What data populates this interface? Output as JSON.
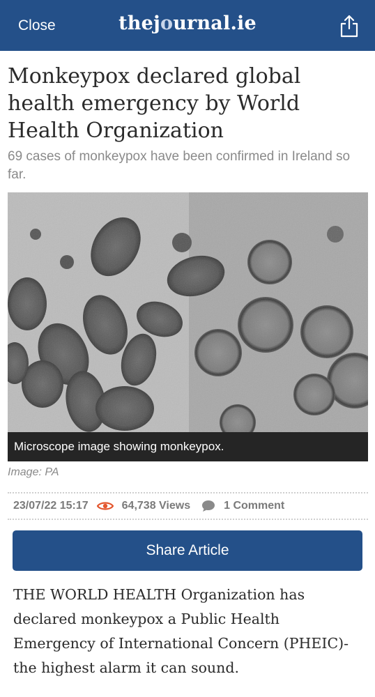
{
  "topbar": {
    "close_label": "Close",
    "brand_prefix": "the",
    "brand_mid": "j",
    "brand_o": "o",
    "brand_rest": "urnal",
    "brand_suffix": ".ie",
    "share_icon": "share-icon",
    "bg_color": "#245089"
  },
  "article": {
    "headline": "Monkeypox declared global health emergency by World Health Organization",
    "subtitle": "69 cases of monkeypox have been confirmed in Ireland so far.",
    "image_caption": "Microscope image showing monkeypox.",
    "image_credit": "Image: PA",
    "date": "23/07/22 15:17",
    "views_icon": "eye-icon",
    "views": "64,738 Views",
    "comments_icon": "comment-icon",
    "comments": "1 Comment",
    "share_button": "Share Article",
    "body": "THE WORLD HEALTH Organization has declared monkeypox a Public Health Emergency of International Concern (PHEIC)- the highest alarm it can sound."
  },
  "colors": {
    "accent": "#245089",
    "eye_icon": "#e4572e",
    "muted_text": "#8a8a8a"
  }
}
